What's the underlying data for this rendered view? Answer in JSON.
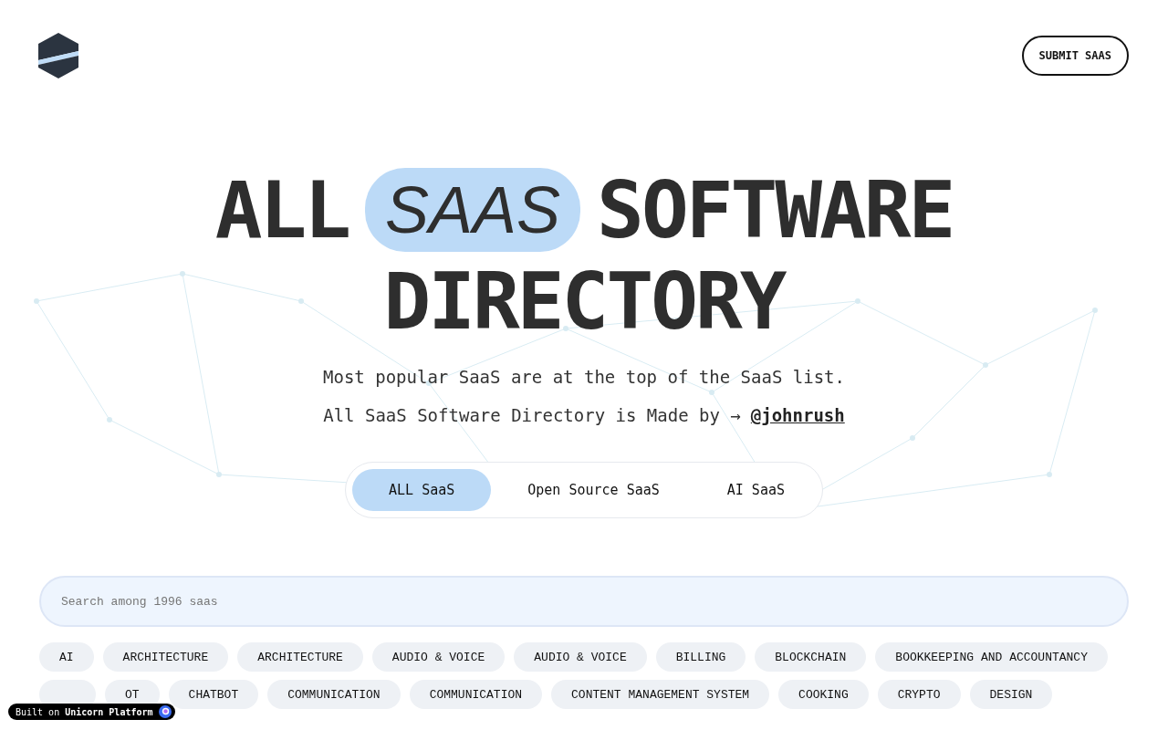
{
  "header": {
    "submit_button": "SUBMIT SAAS"
  },
  "hero": {
    "title_before": "ALL",
    "title_highlight": "SAAS",
    "title_after": "SOFTWARE",
    "title_line2": "DIRECTORY",
    "subtitle": "Most popular SaaS are at the top of the SaaS list.",
    "credit": "All SaaS Software Directory is Made by →",
    "credit_link": "@johnrush"
  },
  "filter_tabs": [
    {
      "label": "ALL SaaS",
      "selected": true
    },
    {
      "label": "Open Source SaaS",
      "selected": false
    },
    {
      "label": "AI SaaS",
      "selected": false
    }
  ],
  "search": {
    "placeholder": "Search among 1996 saas"
  },
  "tag_rows": [
    [
      "AI",
      "ARCHITECTURE",
      "ARCHITECTURE",
      "AUDIO & VOICE",
      "AUDIO & VOICE",
      "BILLING",
      "BLOCKCHAIN",
      "BOOKKEEPING AND ACCOUNTANCY"
    ],
    [
      "",
      "OT",
      "CHATBOT",
      "COMMUNICATION",
      "COMMUNICATION",
      "CONTENT MANAGEMENT SYSTEM",
      "COOKING",
      "CRYPTO",
      "DESIGN"
    ]
  ],
  "badge": {
    "prefix": "Built on",
    "brand": "Unicorn Platform"
  }
}
